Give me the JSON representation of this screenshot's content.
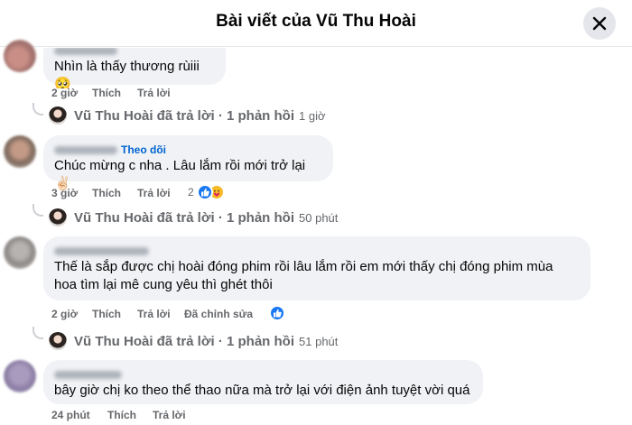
{
  "header": {
    "title": "Bài viết của Vũ Thu Hoài"
  },
  "comments": [
    {
      "text": "Nhìn là thấy thương rùiii 🥺",
      "time": "2 giờ",
      "like": "Thích",
      "reply": "Trả lời"
    },
    {
      "follow": "Theo dõi",
      "text": "Chúc mừng c nha . Lâu lắm rồi mới trở lại ✌🏻",
      "time": "3 giờ",
      "like": "Thích",
      "reply": "Trả lời",
      "reaction_count": "2",
      "reactions": [
        "like",
        "care"
      ]
    },
    {
      "text_lines": [
        "Thế là sắp được chị hoài đóng phim rồi lâu lắm rồi em mới thấy chị đóng phim mùa",
        "hoa tìm lại mê cung yêu thì ghét thôi"
      ],
      "time": "2 giờ",
      "like": "Thích",
      "reply": "Trả lời",
      "edited": "Đã chỉnh sửa",
      "reactions": [
        "like"
      ]
    },
    {
      "text": "bây giờ chị ko theo thể thao nữa mà trở lại với điện ảnh tuyệt vời quá",
      "time": "24 phút",
      "like": "Thích",
      "reply": "Trả lời"
    }
  ],
  "replies": [
    {
      "text": "Vũ Thu Hoài đã trả lời · 1 phản hồi",
      "time": "1 giờ"
    },
    {
      "text": "Vũ Thu Hoài đã trả lời · 1 phản hồi",
      "time": "50 phút"
    },
    {
      "text": "Vũ Thu Hoài đã trả lời · 1 phản hồi",
      "time": "51 phút"
    }
  ],
  "colors": {
    "bubble": "#f0f2f5",
    "meta": "#65676b",
    "link": "#0064d1",
    "like_blue": "#1877f2",
    "care_yellow": "#f7b928"
  },
  "icons": {
    "close": "close-icon",
    "like": "like-reaction-icon",
    "care": "care-reaction-icon"
  }
}
